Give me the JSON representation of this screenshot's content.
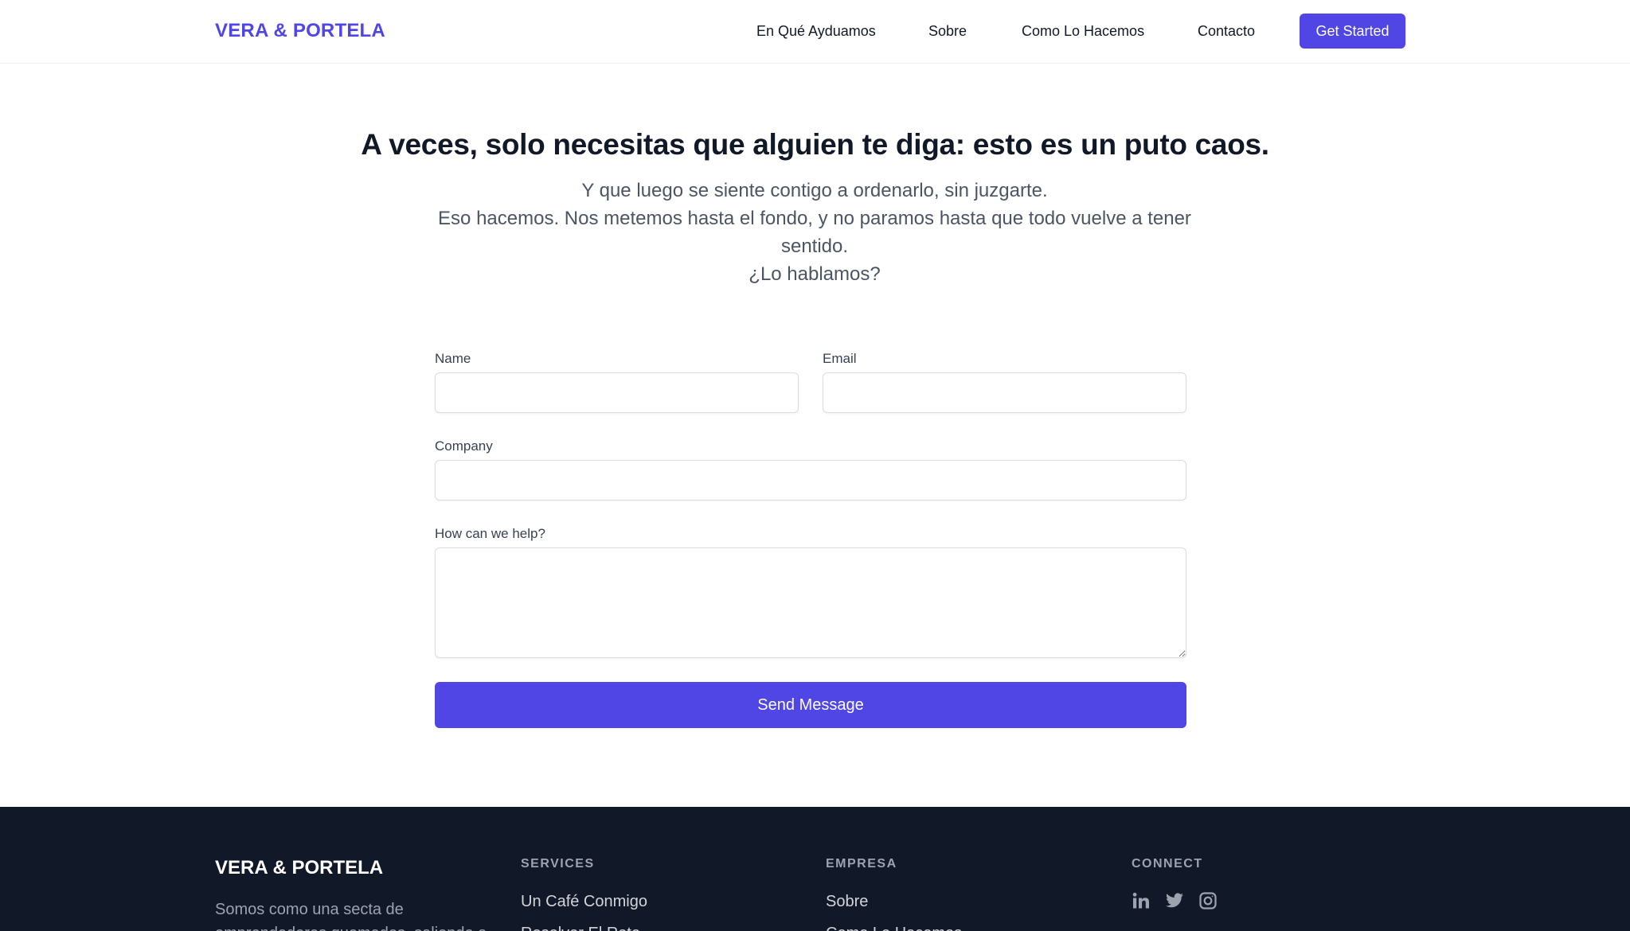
{
  "header": {
    "logo": "VERA & PORTELA",
    "nav": [
      "En Qué Ayduamos",
      "Sobre",
      "Como Lo Hacemos",
      "Contacto"
    ],
    "cta": "Get Started"
  },
  "hero": {
    "title": "A veces, solo necesitas que alguien te diga: esto es un puto caos.",
    "line1": "Y que luego se siente contigo a ordenarlo, sin juzgarte.",
    "line2": "Eso hacemos. Nos metemos hasta el fondo, y no paramos hasta que todo vuelve a tener sentido.",
    "line3": "¿Lo hablamos?"
  },
  "form": {
    "name_label": "Name",
    "email_label": "Email",
    "company_label": "Company",
    "help_label": "How can we help?",
    "name_value": "",
    "email_value": "",
    "company_value": "",
    "help_value": "",
    "submit": "Send Message"
  },
  "footer": {
    "logo": "VERA & PORTELA",
    "description": "Somos como una secta de emprendedores quemados, saliendo a",
    "services_heading": "SERVICES",
    "services": [
      "Un Café Conmigo",
      "Resolver El Reto"
    ],
    "company_heading": "EMPRESA",
    "company": [
      "Sobre",
      "Como Lo Hacemos"
    ],
    "connect_heading": "CONNECT",
    "social_icons": [
      "linkedin-icon",
      "twitter-icon",
      "instagram-icon"
    ]
  },
  "colors": {
    "accent": "#4f46e5",
    "footer_bg": "#111827",
    "text": "#111827",
    "muted": "#4b5563"
  }
}
